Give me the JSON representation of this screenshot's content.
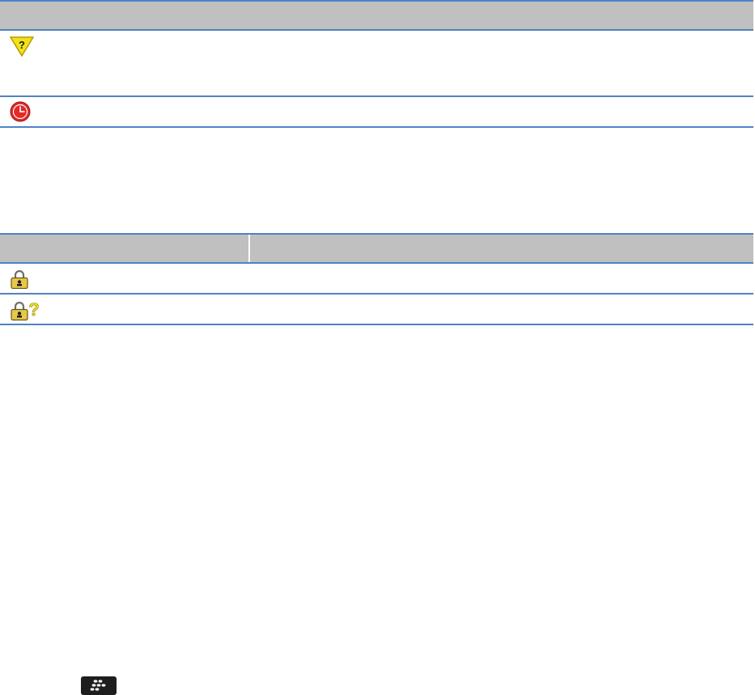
{
  "icons": {
    "row1": "warning-question-icon",
    "row2": "red-clock-icon",
    "row3": "padlock-icon",
    "row4": "padlock-question-icon",
    "footer": "blackberry-menu-key-icon"
  },
  "colors": {
    "header_background": "#c0c0c0",
    "rule": "#4f82c4",
    "warning_yellow": "#f2e21a",
    "clock_red": "#e12a2a",
    "lock_gold": "#e6c84a",
    "key_black": "#1e1e1e"
  }
}
